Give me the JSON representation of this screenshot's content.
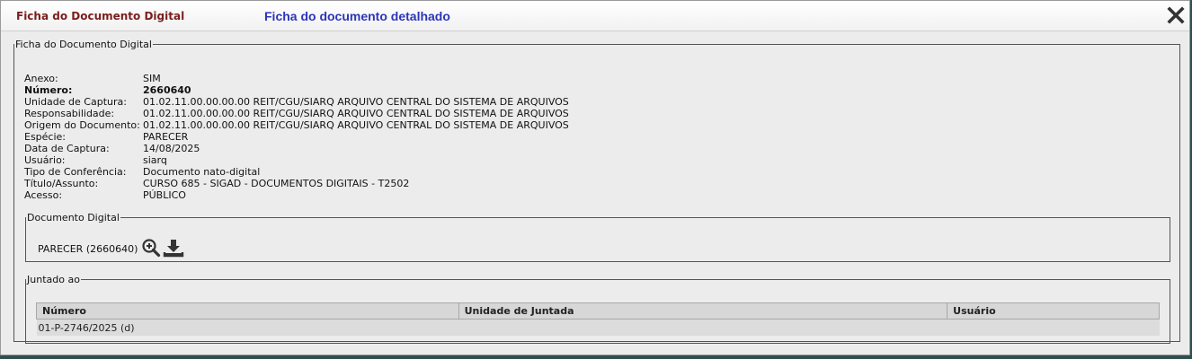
{
  "window": {
    "title": "Ficha do Documento Digital",
    "subtitle": "Ficha do documento detalhado",
    "close_icon": "close-icon"
  },
  "ficha": {
    "legend": "Ficha do Documento Digital",
    "fields": [
      {
        "label": "Anexo:",
        "value": "SIM",
        "bold": false
      },
      {
        "label": "Número:",
        "value": "2660640",
        "bold": true
      },
      {
        "label": "Unidade de Captura:",
        "value": "01.02.11.00.00.00.00 REIT/CGU/SIARQ ARQUIVO CENTRAL DO SISTEMA DE ARQUIVOS",
        "bold": false
      },
      {
        "label": "Responsabilidade:",
        "value": "01.02.11.00.00.00.00 REIT/CGU/SIARQ ARQUIVO CENTRAL DO SISTEMA DE ARQUIVOS",
        "bold": false
      },
      {
        "label": "Origem do Documento:",
        "value": "01.02.11.00.00.00.00 REIT/CGU/SIARQ ARQUIVO CENTRAL DO SISTEMA DE ARQUIVOS",
        "bold": false
      },
      {
        "label": "Espécie:",
        "value": "PARECER",
        "bold": false
      },
      {
        "label": "Data de Captura:",
        "value": "14/08/2025",
        "bold": false
      },
      {
        "label": "Usuário:",
        "value": "siarq",
        "bold": false
      },
      {
        "label": "Tipo de Conferência:",
        "value": "Documento nato-digital",
        "bold": false
      },
      {
        "label": "Título/Assunto:",
        "value": "CURSO 685 - SIGAD - DOCUMENTOS DIGITAIS - T2502",
        "bold": false
      },
      {
        "label": "Acesso:",
        "value": "PÚBLICO",
        "bold": false
      }
    ]
  },
  "documento_digital": {
    "legend": "Documento Digital",
    "item": "PARECER (2660640)",
    "icons": [
      "zoom-in-icon",
      "download-icon"
    ]
  },
  "juntado": {
    "legend": "Juntado ao",
    "columns": [
      "Número",
      "Unidade de Juntada",
      "Usuário"
    ],
    "rows": [
      [
        "01-P-2746/2025 (d)",
        "",
        ""
      ]
    ]
  }
}
